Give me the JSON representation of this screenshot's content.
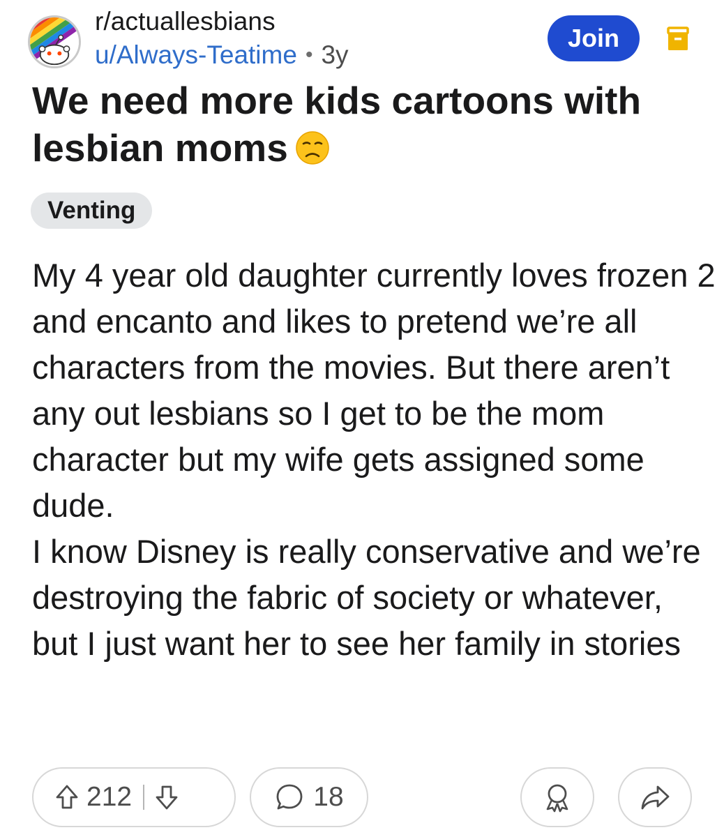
{
  "header": {
    "subreddit": "r/actuallesbians",
    "username": "u/Always-Teatime",
    "separator": "•",
    "age": "3y",
    "join_label": "Join",
    "join_color": "#1f4bd0",
    "save_icon": "bookmark-icon",
    "save_icon_color": "#f0b400"
  },
  "post": {
    "title": "We need more kids cartoons with lesbian moms",
    "title_emoji": "disappointed-face-emoji",
    "flair": "Venting",
    "body": [
      "My 4 year old daughter currently loves frozen 2 and encanto and likes to pretend we’re all characters from the movies.  But there aren’t any out lesbians so I get to be the mom character but my wife gets assigned some dude.",
      "I know Disney is really conservative and we’re destroying the fabric of society or whatever, but I just want her to see her family in stories"
    ]
  },
  "actions": {
    "upvote_icon": "upvote-arrow-icon",
    "vote_count": "212",
    "downvote_icon": "downvote-arrow-icon",
    "comment_icon": "comment-bubble-icon",
    "comment_count": "18",
    "award_icon": "award-icon",
    "share_icon": "share-arrow-icon"
  }
}
